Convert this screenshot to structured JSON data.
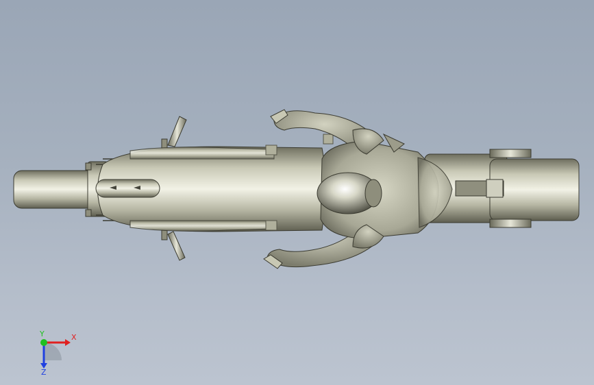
{
  "viewport": {
    "background_top": "#9aa6b6",
    "background_bottom": "#bcc4d0",
    "model_color": "#b8b8a4"
  },
  "triad": {
    "x_label": "X",
    "y_label": "Y",
    "z_label": "Z",
    "x_color": "#e02020",
    "y_color": "#20c020",
    "z_color": "#2040e0"
  }
}
